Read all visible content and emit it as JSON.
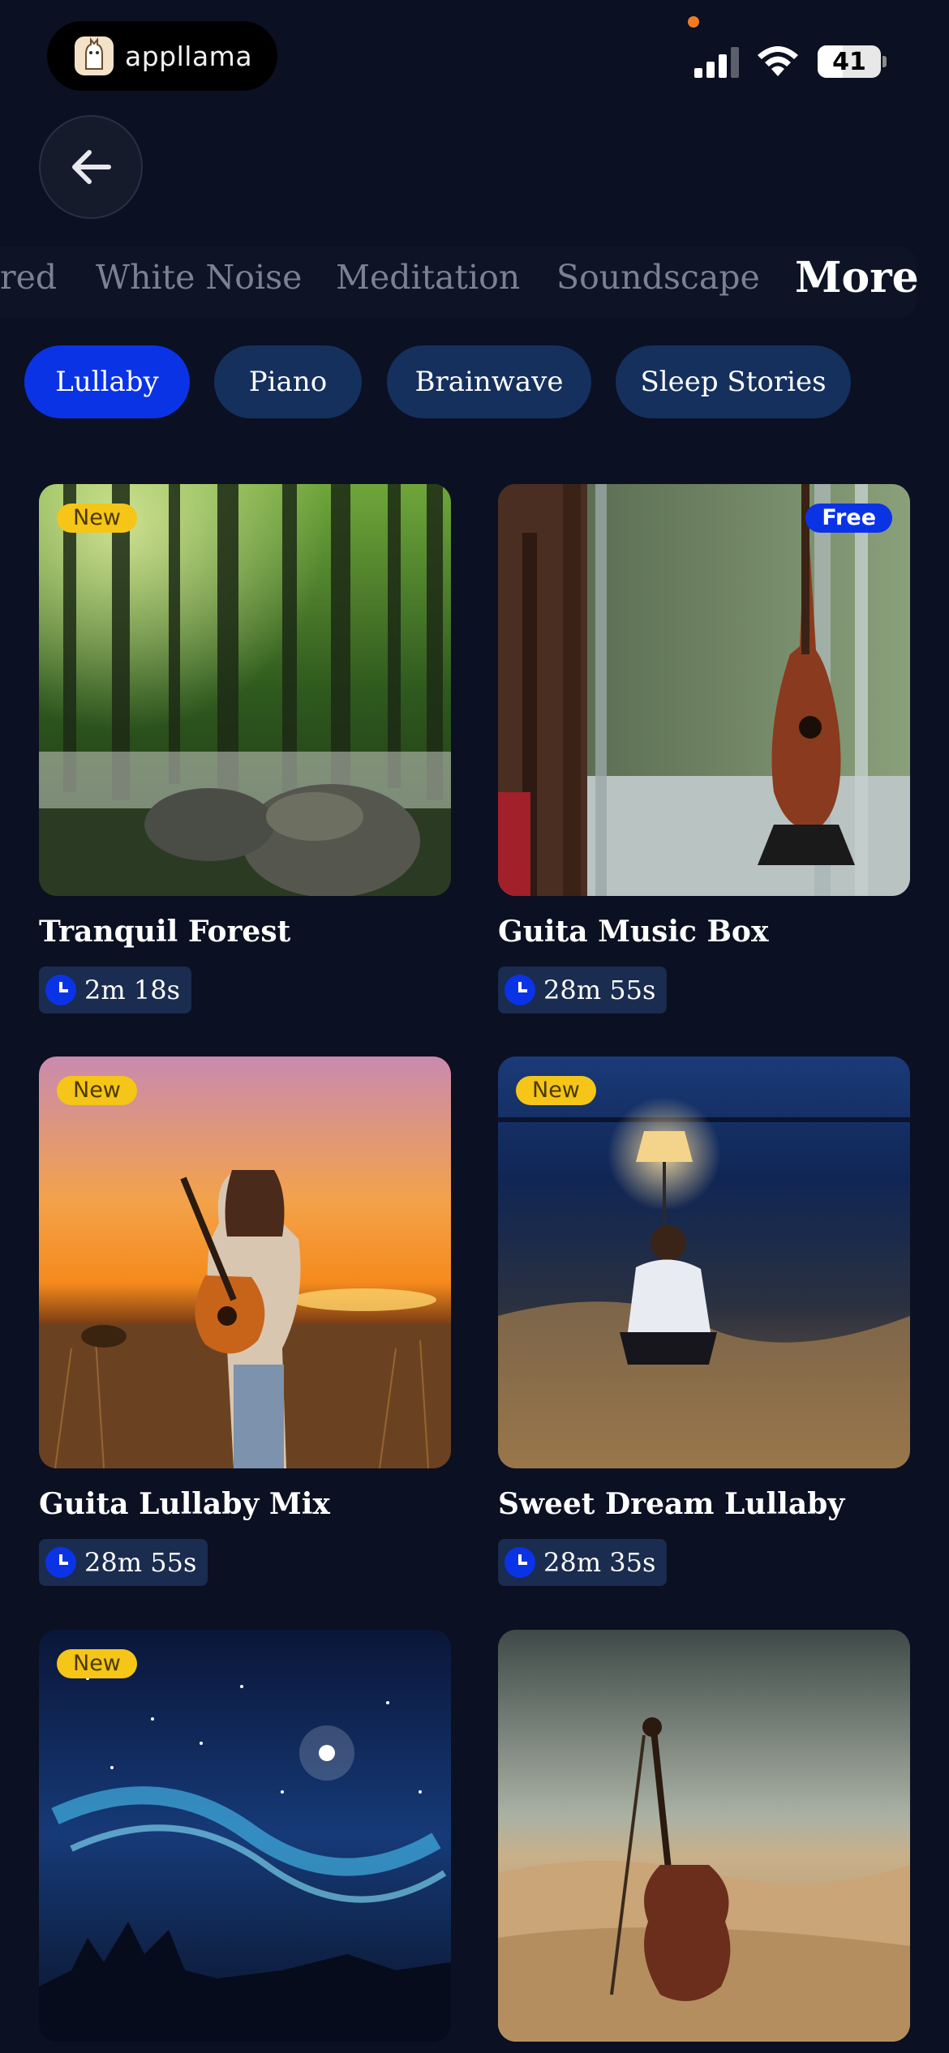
{
  "status_bar": {
    "app_name": "appllama",
    "battery": "41"
  },
  "categories": [
    {
      "label": "red"
    },
    {
      "label": "White Noise"
    },
    {
      "label": "Meditation"
    },
    {
      "label": "Soundscape"
    },
    {
      "label": "More",
      "active": true
    }
  ],
  "chips": [
    {
      "label": "Lullaby",
      "active": true
    },
    {
      "label": "Piano"
    },
    {
      "label": "Brainwave"
    },
    {
      "label": "Sleep Stories"
    }
  ],
  "cards": [
    {
      "title": "Tranquil Forest",
      "duration": "2m 18s",
      "badge": "New",
      "image": "misty forest"
    },
    {
      "title": "Guita Music Box",
      "duration": "28m 55s",
      "badge": "Free",
      "image": "guitar by chair"
    },
    {
      "title": "Guita Lullaby Mix",
      "duration": "28m 55s",
      "badge": "New",
      "image": "sunset guitarist"
    },
    {
      "title": "Sweet Dream Lullaby",
      "duration": "28m 35s",
      "badge": "New",
      "image": "lamp on beach"
    },
    {
      "title": "",
      "duration": "",
      "badge": "New",
      "image": "starry night sky"
    },
    {
      "title": "",
      "duration": "",
      "badge": "",
      "image": "violin in desert"
    }
  ],
  "colors": {
    "background": "#0b1022",
    "accent": "#0b33e6",
    "chip": "#15305d",
    "new_badge": "#f5c518"
  }
}
